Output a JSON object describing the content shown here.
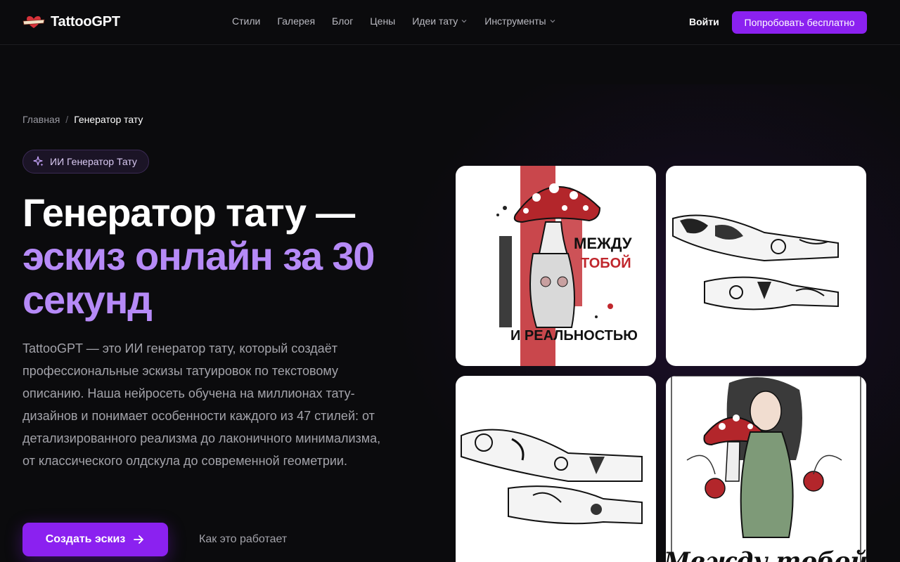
{
  "header": {
    "logo_text": "TattooGPT",
    "nav": [
      {
        "label": "Стили"
      },
      {
        "label": "Галерея"
      },
      {
        "label": "Блог"
      },
      {
        "label": "Цены"
      },
      {
        "label": "Идеи тату",
        "dropdown": true
      },
      {
        "label": "Инструменты",
        "dropdown": true
      }
    ],
    "login_label": "Войти",
    "cta_label": "Попробовать бесплатно"
  },
  "breadcrumb": {
    "home": "Главная",
    "separator": "/",
    "current": "Генератор тату"
  },
  "hero": {
    "badge": "ИИ Генератор Тату",
    "title_line1": "Генератор тату —",
    "title_accent": "эскиз онлайн за 30 секунд",
    "description": "TattooGPT — это ИИ генератор тату, который создаёт профессиональные эскизы татуировок по текстовому описанию. Наша нейросеть обучена на миллионах тату-дизайнов и понимает особенности каждого из 47 стилей: от детализированного реализма до лаконичного минимализма, от классического олдскула до современной геометрии.",
    "cta_label": "Создать эскиз",
    "secondary_label": "Как это работает"
  },
  "gallery": {
    "card1_text": [
      "МЕЖДУ",
      "ТОБОЙ",
      "И РЕАЛЬНОСТЬЮ"
    ],
    "card4_text": "Между тобой"
  },
  "colors": {
    "accent": "#8b21f0",
    "accent_text": "#b68af7",
    "background": "#0b0b0d",
    "tattoo_red": "#c0272d"
  }
}
